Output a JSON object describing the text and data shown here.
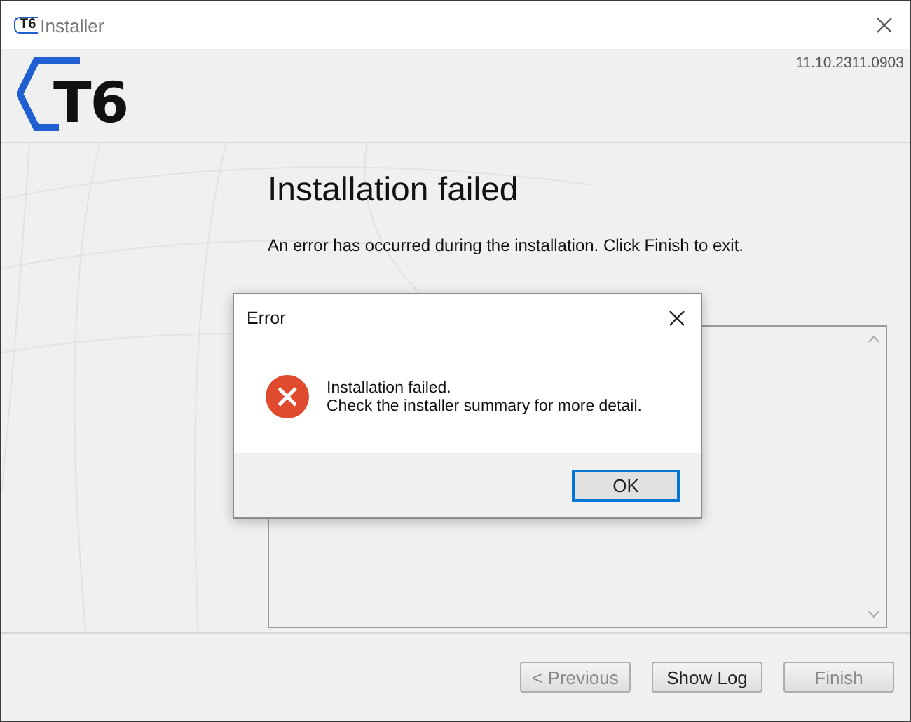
{
  "window": {
    "icon_text": "T6",
    "title": "Installer",
    "logo_text": "T6",
    "version": "11.10.2311.0903"
  },
  "page": {
    "heading": "Installation failed",
    "message": "An error has occurred during the installation. Click Finish to exit."
  },
  "buttons": [
    {
      "label": "< Previous",
      "disabled": true
    },
    {
      "label": "Show Log",
      "disabled": false
    },
    {
      "label": "Finish",
      "disabled": true
    }
  ],
  "dialog": {
    "title": "Error",
    "lines": [
      "Installation failed.",
      "Check the installer summary for more detail."
    ],
    "buttons": [
      {
        "label": "OK",
        "default": true
      }
    ]
  }
}
